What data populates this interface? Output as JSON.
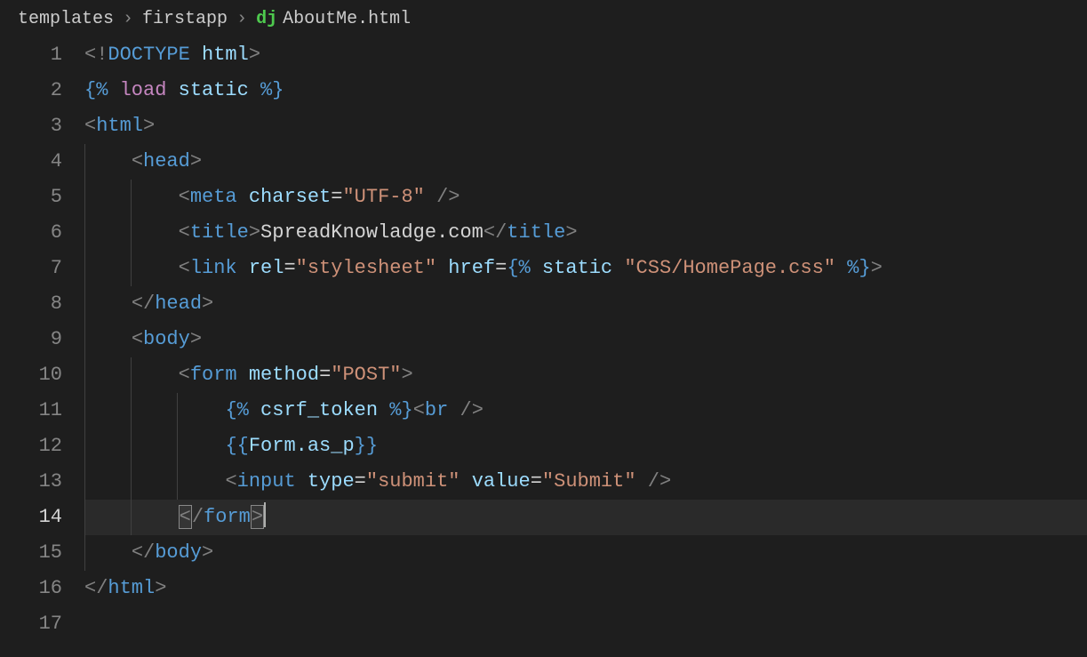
{
  "breadcrumb": {
    "seg1": "templates",
    "seg2": "firstapp",
    "seg3": "AboutMe.html",
    "icon": "dj"
  },
  "lineNumbers": [
    "1",
    "2",
    "3",
    "4",
    "5",
    "6",
    "7",
    "8",
    "9",
    "10",
    "11",
    "12",
    "13",
    "14",
    "15",
    "16",
    "17"
  ],
  "activeLine": "14",
  "code": {
    "l1": {
      "p1": "<!",
      "p2": "DOCTYPE",
      "p3": " ",
      "p4": "html",
      "p5": ">"
    },
    "l2": {
      "p1": "{% ",
      "p2": "load",
      "p3": " ",
      "p4": "static",
      "p5": " %}"
    },
    "l3": {
      "p1": "<",
      "p2": "html",
      "p3": ">"
    },
    "l4": {
      "p1": "<",
      "p2": "head",
      "p3": ">"
    },
    "l5": {
      "p1": "<",
      "p2": "meta",
      "p3": " ",
      "p4": "charset",
      "p5": "=",
      "p6": "\"UTF-8\"",
      "p7": " />"
    },
    "l6": {
      "p1": "<",
      "p2": "title",
      "p3": ">",
      "p4": "SpreadKnowladge.com",
      "p5": "</",
      "p6": "title",
      "p7": ">"
    },
    "l7": {
      "p1": "<",
      "p2": "link",
      "p3": " ",
      "p4": "rel",
      "p5": "=",
      "p6": "\"stylesheet\"",
      "p7": " ",
      "p8": "href",
      "p9": "=",
      "p10": "{% ",
      "p11": "static",
      "p12": " ",
      "p13": "\"CSS/HomePage.css\"",
      "p14": " %}",
      "p15": ">"
    },
    "l8": {
      "p1": "</",
      "p2": "head",
      "p3": ">"
    },
    "l9": {
      "p1": "<",
      "p2": "body",
      "p3": ">"
    },
    "l10": {
      "p1": "<",
      "p2": "form",
      "p3": " ",
      "p4": "method",
      "p5": "=",
      "p6": "\"POST\"",
      "p7": ">"
    },
    "l11": {
      "p1": "{% ",
      "p2": "csrf_token",
      "p3": " %}",
      "p4": "<",
      "p5": "br",
      "p6": " />"
    },
    "l12": {
      "p1": "{{",
      "p2": "Form.as_p",
      "p3": "}}"
    },
    "l13": {
      "p1": "<",
      "p2": "input",
      "p3": " ",
      "p4": "type",
      "p5": "=",
      "p6": "\"submit\"",
      "p7": " ",
      "p8": "value",
      "p9": "=",
      "p10": "\"Submit\"",
      "p11": " />"
    },
    "l14": {
      "p1": "<",
      "p2": "/",
      "p3": "form",
      "p4": ">"
    },
    "l15": {
      "p1": "</",
      "p2": "body",
      "p3": ">"
    },
    "l16": {
      "p1": "</",
      "p2": "html",
      "p3": ">"
    }
  }
}
